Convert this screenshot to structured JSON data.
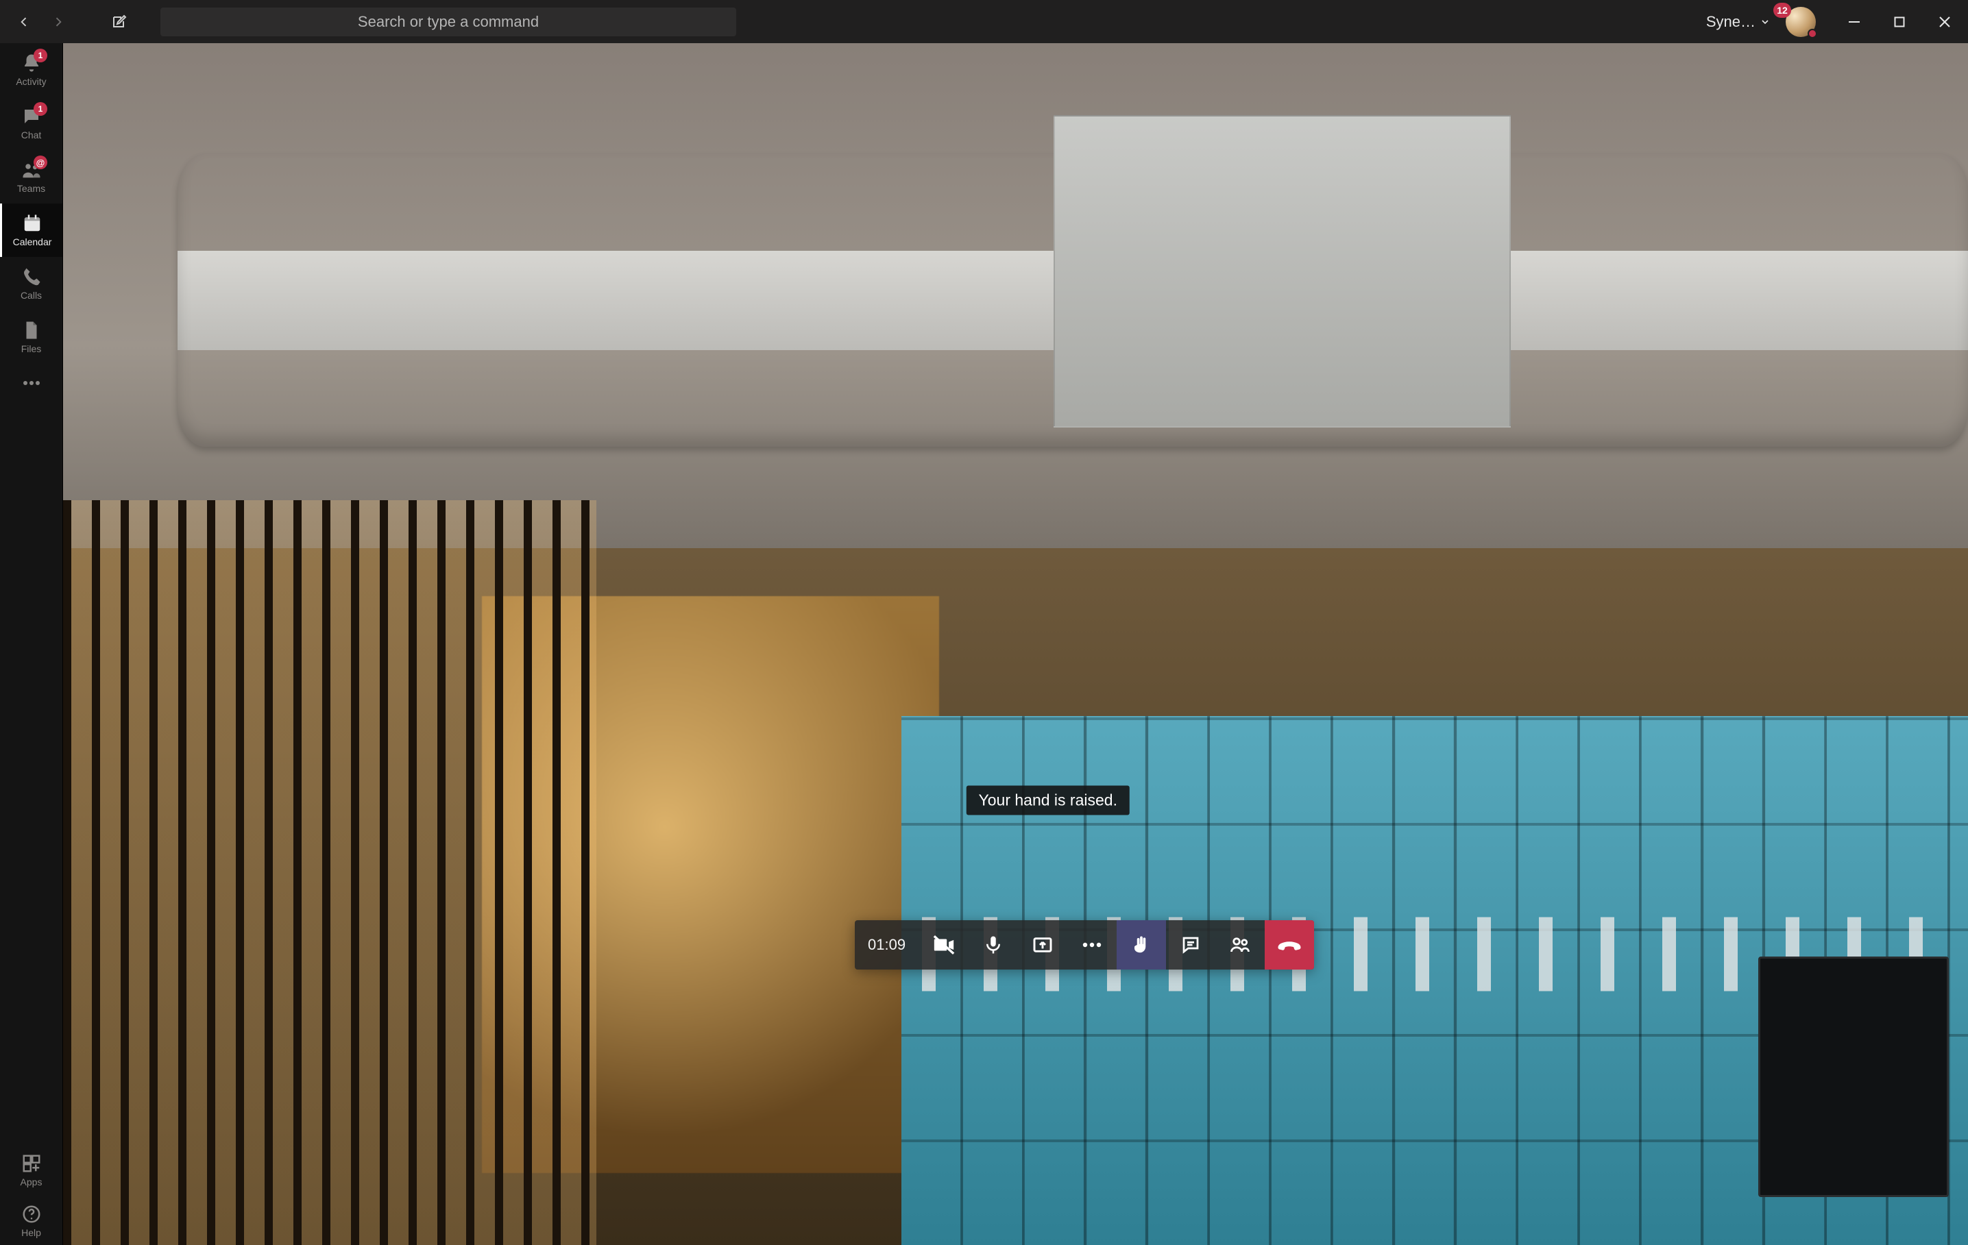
{
  "titlebar": {
    "search_placeholder": "Search or type a command",
    "org_name": "Syne…",
    "notif_count": "12"
  },
  "sidebar": {
    "items": [
      {
        "id": "activity",
        "label": "Activity",
        "badge": "1",
        "badge_kind": "count"
      },
      {
        "id": "chat",
        "label": "Chat",
        "badge": "1",
        "badge_kind": "count"
      },
      {
        "id": "teams",
        "label": "Teams",
        "badge": "@",
        "badge_kind": "mention"
      },
      {
        "id": "calendar",
        "label": "Calendar",
        "selected": true
      },
      {
        "id": "calls",
        "label": "Calls"
      },
      {
        "id": "files",
        "label": "Files"
      }
    ],
    "overflow_label": "",
    "apps": {
      "label": "Apps"
    },
    "help": {
      "label": "Help"
    }
  },
  "call": {
    "duration": "01:09",
    "tooltip": "Your hand is raised."
  }
}
